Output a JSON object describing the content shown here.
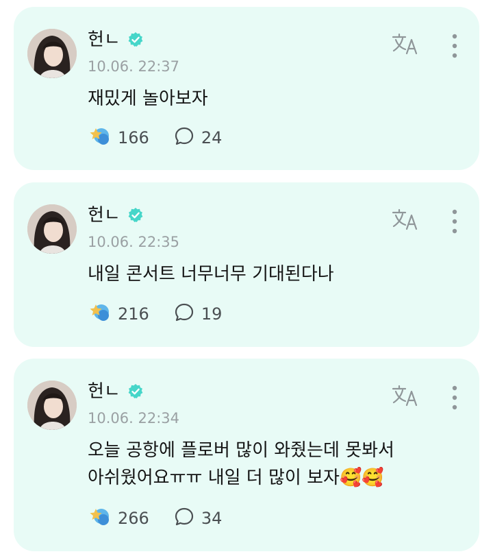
{
  "posts": [
    {
      "author": "헌ㄴ",
      "timestamp": "10.06. 22:37",
      "content": "재밌게 놀아보자",
      "likes": "166",
      "comments": "24"
    },
    {
      "author": "헌ㄴ",
      "timestamp": "10.06. 22:35",
      "content": "내일 콘서트 너무너무 기대된다나",
      "likes": "216",
      "comments": "19"
    },
    {
      "author": "헌ㄴ",
      "timestamp": "10.06. 22:34",
      "content": "오늘 공항에 플로버 많이 와줬는데 못봐서\n아쉬웠어요ㅠㅠ 내일 더 많이 보자🥰🥰",
      "likes": "266",
      "comments": "34"
    }
  ],
  "icons": {
    "verified": "verified-badge-icon",
    "translate": "translate-icon",
    "more": "more-vertical-icon",
    "like": "star-reaction-icon",
    "comment": "comment-bubble-icon"
  },
  "colors": {
    "card_background": "#e8fbf6",
    "verified_badge": "#46d6c9",
    "timestamp": "#9aa0a3",
    "icon_gray": "#8f9699"
  }
}
